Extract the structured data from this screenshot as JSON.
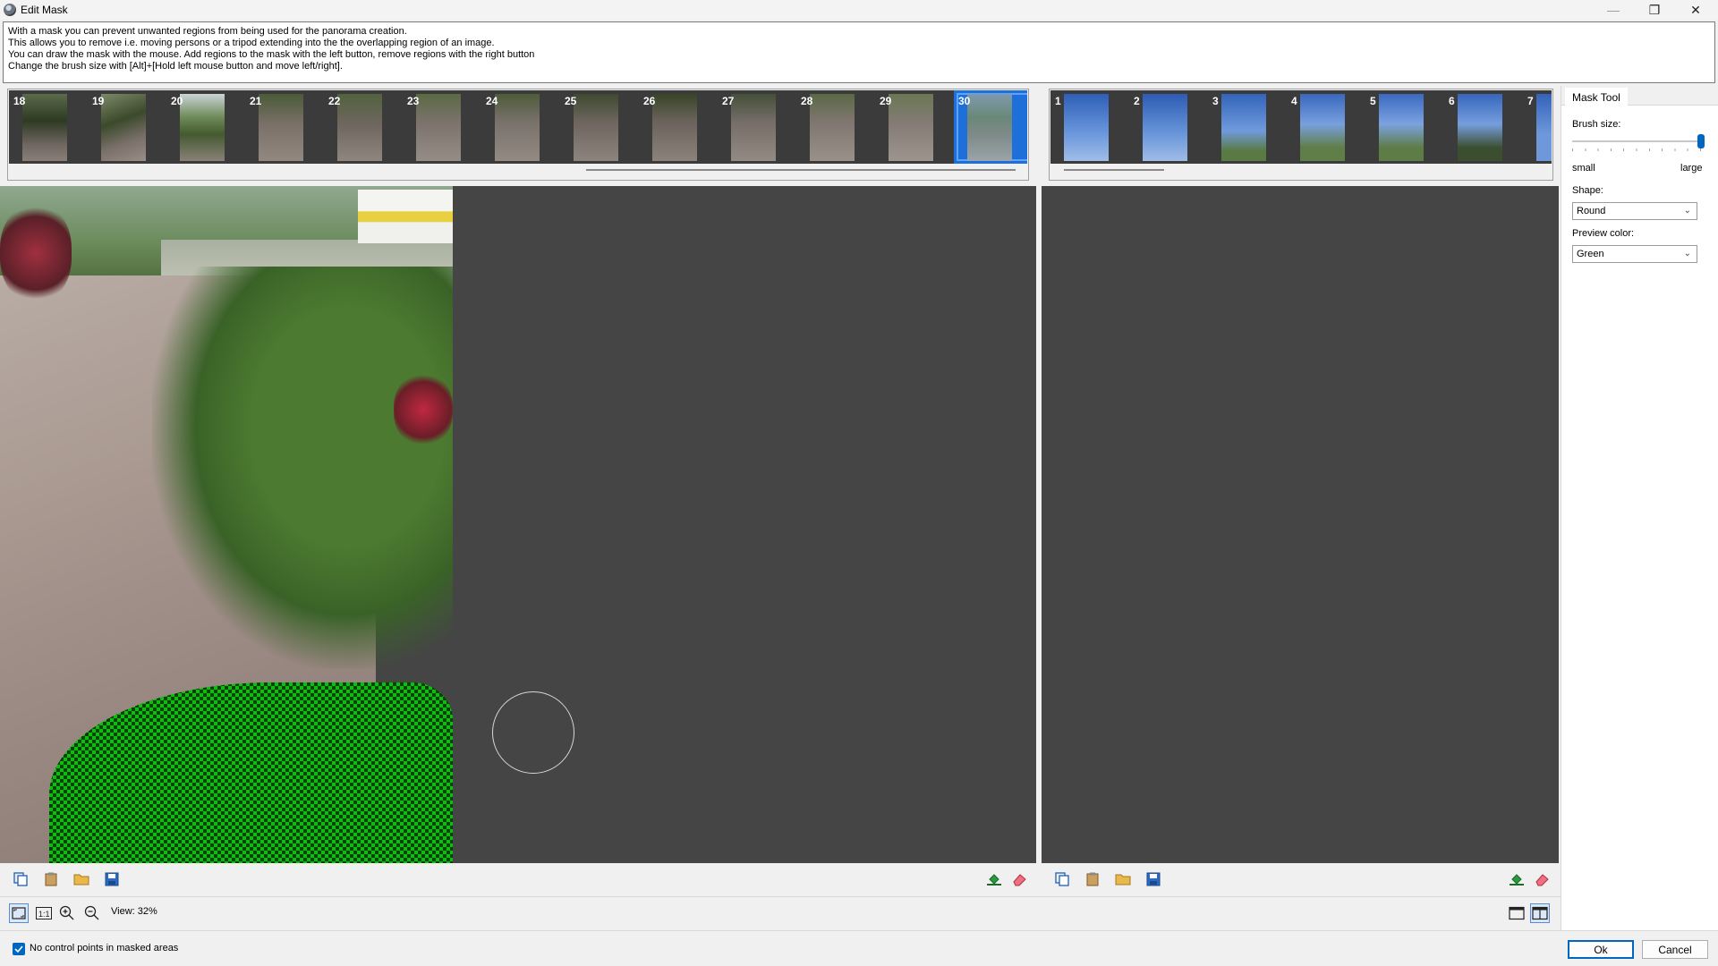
{
  "window": {
    "title": "Edit Mask",
    "controls": {
      "minimize": "—",
      "maximize": "❐",
      "close": "✕"
    }
  },
  "help_lines": [
    "With a mask you can prevent unwanted regions from being used for the panorama creation.",
    "This allows you to remove i.e. moving persons or a tripod extending into the the overlapping region of an image.",
    "You can draw the mask with the mouse. Add regions to the mask with the left button, remove regions with the right button",
    "Change the brush size with [Alt]+[Hold left mouse button and move left/right]."
  ],
  "left_strip": {
    "thumbs": [
      "18",
      "19",
      "20",
      "21",
      "22",
      "23",
      "24",
      "25",
      "26",
      "27",
      "28",
      "29",
      "30"
    ],
    "selected": "30"
  },
  "right_strip": {
    "thumbs": [
      "1",
      "2",
      "3",
      "4",
      "5",
      "6",
      "7"
    ]
  },
  "mask_tool": {
    "tab_label": "Mask Tool",
    "brush_size_label": "Brush size:",
    "brush_size_value": 1.0,
    "slider_min_label": "small",
    "slider_max_label": "large",
    "shape_label": "Shape:",
    "shape_value": "Round",
    "preview_color_label": "Preview color:",
    "preview_color_value": "Green"
  },
  "view": {
    "zoom_label": "View: 32%"
  },
  "options": {
    "no_cp_checkbox_label": "No control points in masked areas",
    "no_cp_checked": true
  },
  "buttons": {
    "ok": "Ok",
    "cancel": "Cancel"
  },
  "icons": {
    "copy": "copy-icon",
    "paste": "paste-icon",
    "open": "folder-open-icon",
    "save": "save-icon",
    "fill": "fill-mask-icon",
    "eraser": "eraser-icon",
    "fit": "fit-to-window-icon",
    "one_to_one": "actual-size-icon",
    "zoom_in": "zoom-in-icon",
    "zoom_out": "zoom-out-icon",
    "single_view": "single-view-icon",
    "split_view": "split-view-icon"
  },
  "colors": {
    "accent": "#0067c0",
    "selection": "#1e6fd9",
    "mask_preview": "#00c800",
    "pane_bg": "#454545"
  }
}
